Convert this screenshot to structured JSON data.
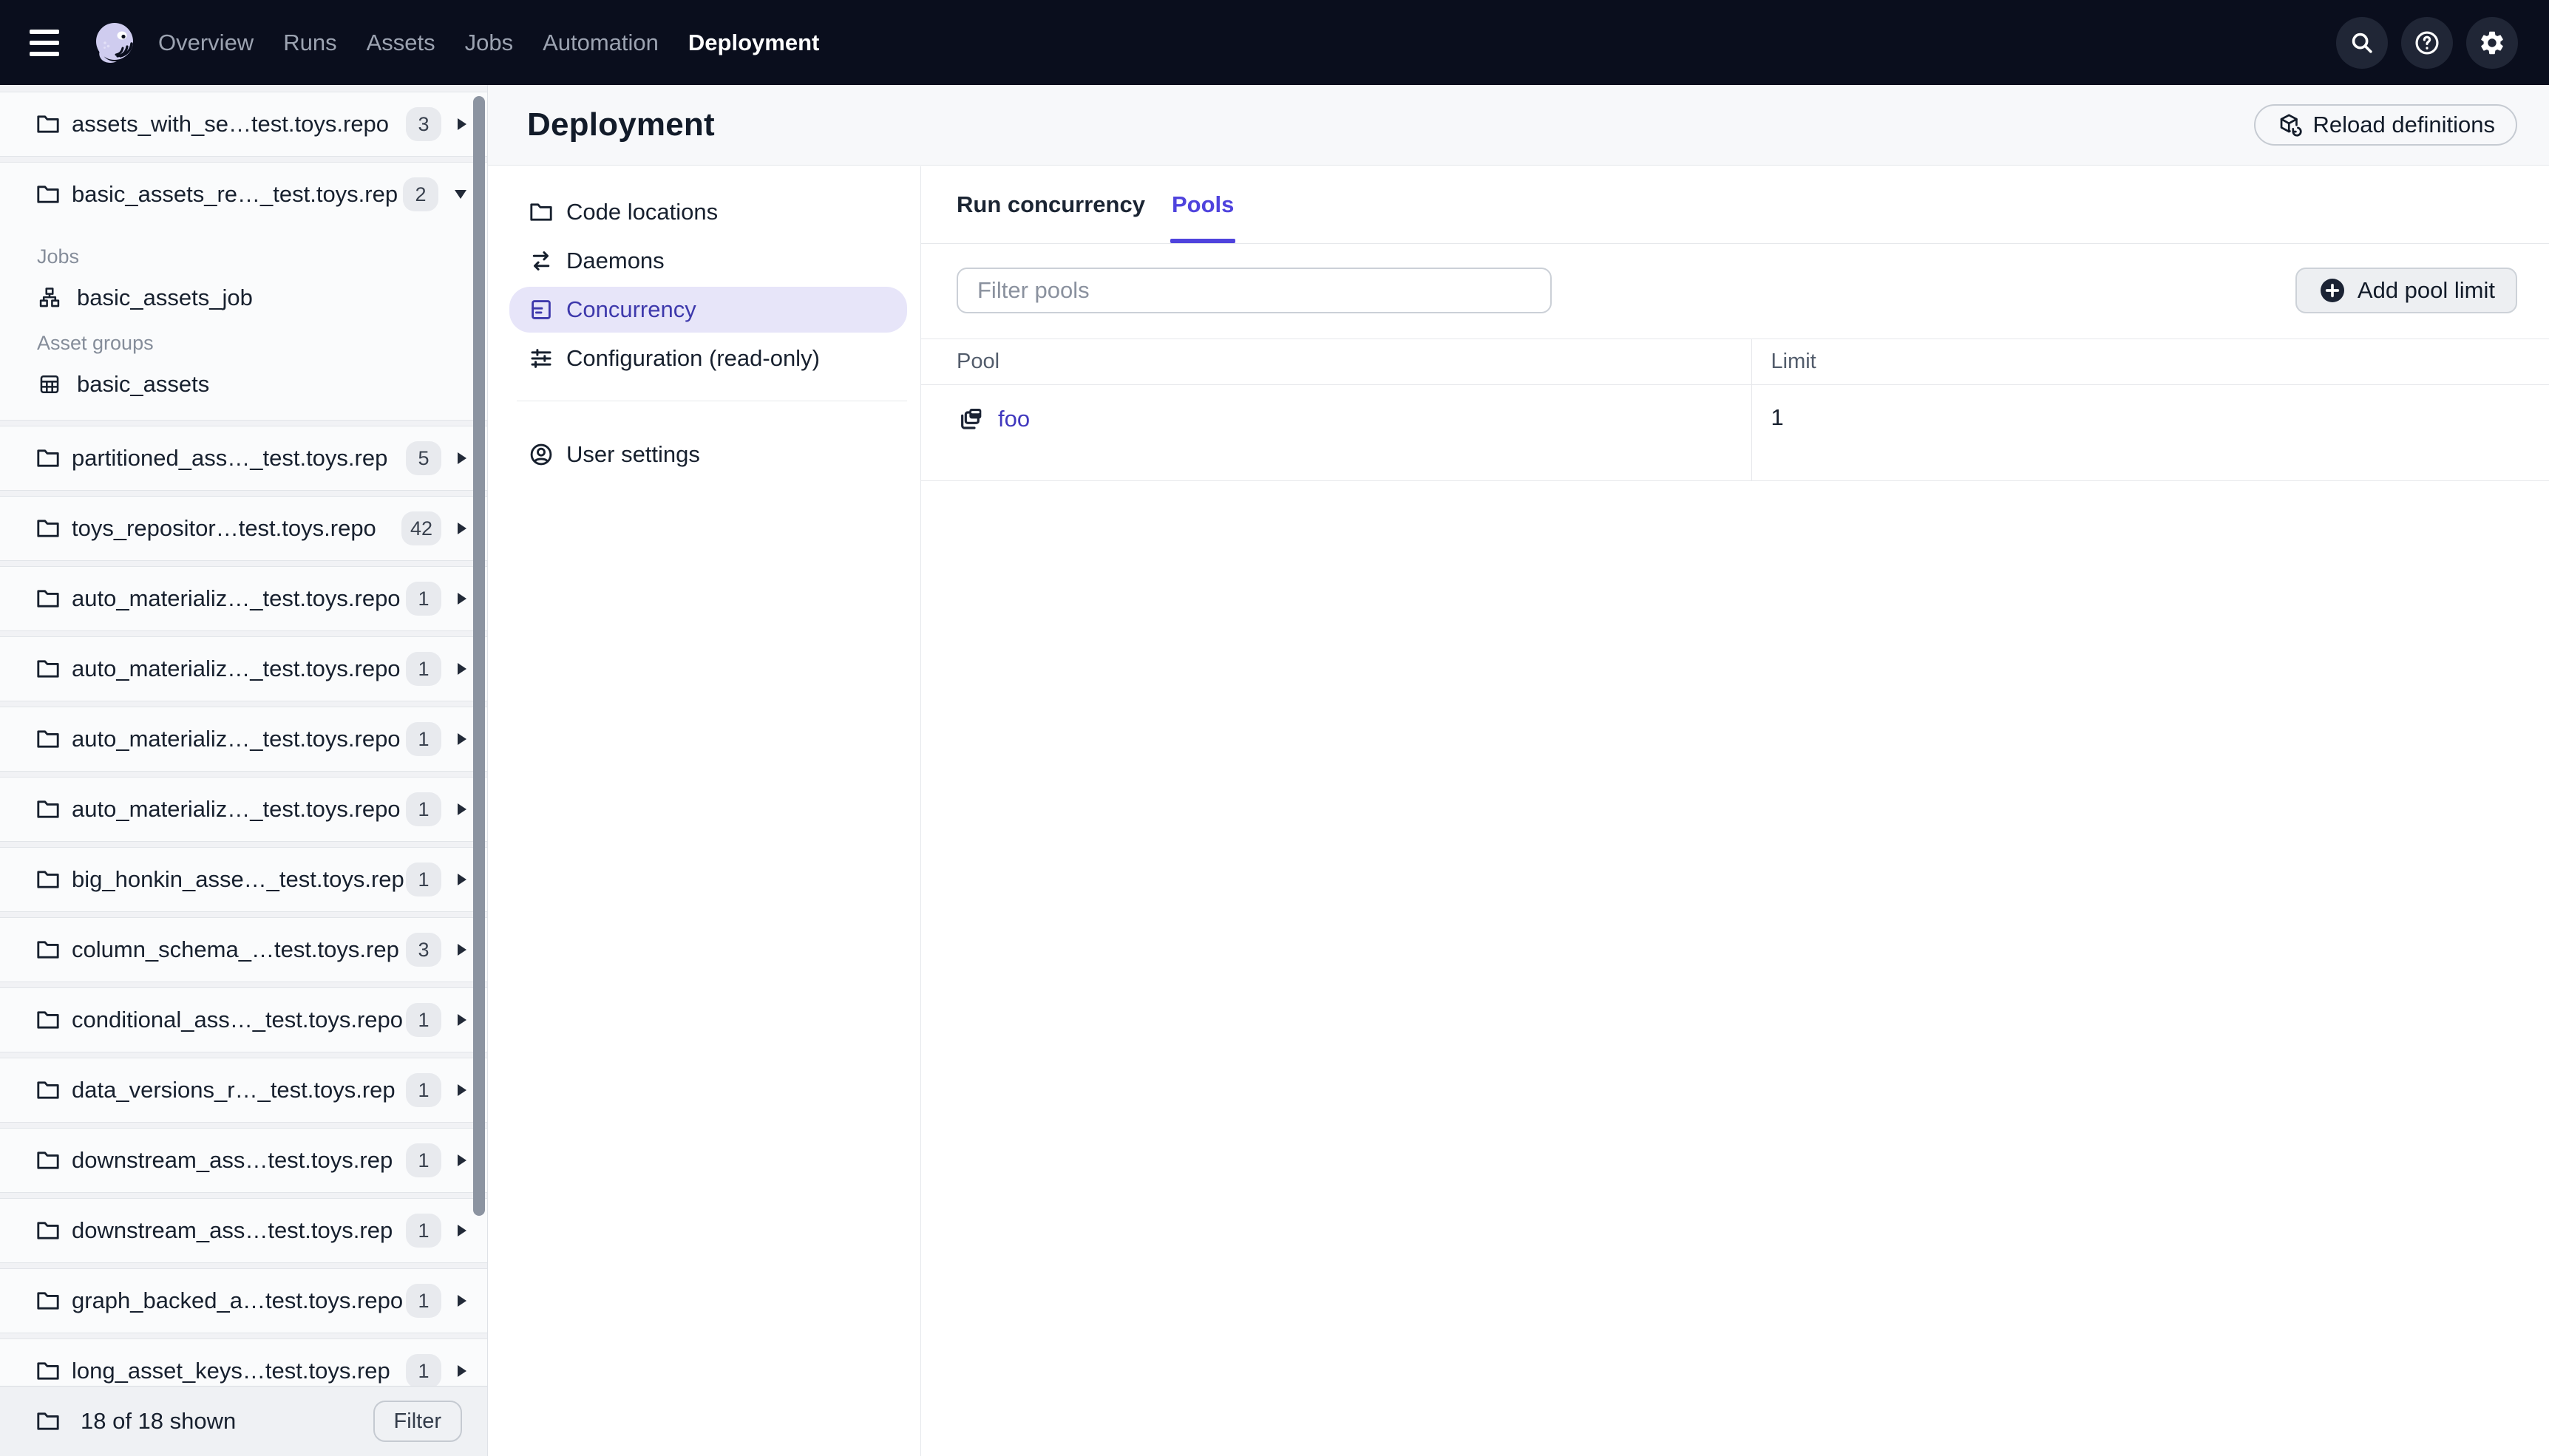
{
  "colors": {
    "topnav_bg": "#0A0E1D",
    "accent": "#4F43DD",
    "selected_nav_bg": "#E7E5F9",
    "selected_nav_text": "#3E39AC",
    "link": "#4038BE",
    "sidebar_bg": "#F1F2F5",
    "band_bg": "#F7F8FA",
    "badge_bg": "#E8EAEE"
  },
  "topnav": {
    "items": [
      {
        "label": "Overview"
      },
      {
        "label": "Runs"
      },
      {
        "label": "Assets"
      },
      {
        "label": "Jobs"
      },
      {
        "label": "Automation"
      },
      {
        "label": "Deployment"
      }
    ]
  },
  "sidebar": {
    "repos": [
      {
        "name": "assets_with_se…test.toys.repo",
        "count": "3"
      },
      {
        "name": "basic_assets_re…_test.toys.rep",
        "count": "2",
        "sections": [
          {
            "title": "Jobs",
            "items": [
              {
                "label": "basic_assets_job"
              }
            ]
          },
          {
            "title": "Asset groups",
            "items": [
              {
                "label": "basic_assets"
              }
            ]
          }
        ]
      },
      {
        "name": "partitioned_ass…_test.toys.rep",
        "count": "5"
      },
      {
        "name": "toys_repositor…test.toys.repo",
        "count": "42"
      },
      {
        "name": "auto_materializ…_test.toys.repo",
        "count": "1"
      },
      {
        "name": "auto_materializ…_test.toys.repo",
        "count": "1"
      },
      {
        "name": "auto_materializ…_test.toys.repo",
        "count": "1"
      },
      {
        "name": "auto_materializ…_test.toys.repo",
        "count": "1"
      },
      {
        "name": "big_honkin_asse…_test.toys.rep",
        "count": "1"
      },
      {
        "name": "column_schema_…test.toys.rep",
        "count": "3"
      },
      {
        "name": "conditional_ass…_test.toys.repo",
        "count": "1"
      },
      {
        "name": "data_versions_r…_test.toys.rep",
        "count": "1"
      },
      {
        "name": "downstream_ass…test.toys.rep",
        "count": "1"
      },
      {
        "name": "downstream_ass…test.toys.rep",
        "count": "1"
      },
      {
        "name": "graph_backed_a…test.toys.repo",
        "count": "1"
      },
      {
        "name": "long_asset_keys…test.toys.rep",
        "count": "1"
      }
    ],
    "footer": {
      "count_text": "18 of 18 shown",
      "filter_label": "Filter"
    }
  },
  "main": {
    "title": "Deployment",
    "reload_button": "Reload definitions",
    "nav": [
      {
        "label": "Code locations"
      },
      {
        "label": "Daemons"
      },
      {
        "label": "Concurrency"
      },
      {
        "label": "Configuration (read-only)"
      },
      {
        "label": "User settings"
      }
    ],
    "tabs": [
      {
        "label": "Run concurrency"
      },
      {
        "label": "Pools"
      }
    ],
    "filter_placeholder": "Filter pools",
    "add_button": "Add pool limit",
    "table": {
      "columns": [
        "Pool",
        "Limit"
      ],
      "rows": [
        {
          "pool": "foo",
          "limit": "1"
        }
      ]
    }
  }
}
